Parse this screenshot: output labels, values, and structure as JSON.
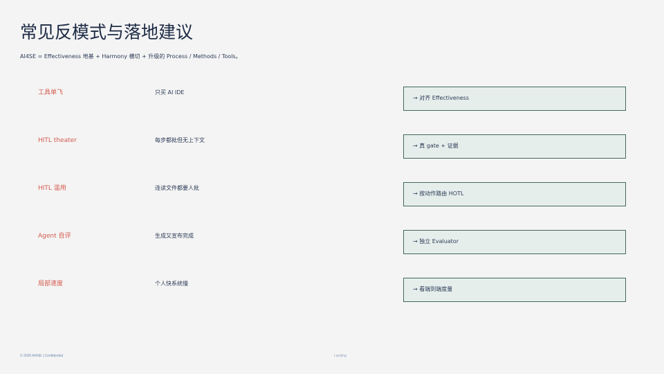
{
  "slide": {
    "title": "常见反模式与落地建议",
    "subtitle": "AI4SE = Effectiveness 地基 + Harmony 横切 + 升级的 Process / Methods / Tools。"
  },
  "rows": [
    {
      "anti_pattern": "工具单飞",
      "symptom": "只买 AI IDE",
      "fix": "→ 对齐 Effectiveness"
    },
    {
      "anti_pattern": "HITL theater",
      "symptom": "每步都批但无上下文",
      "fix": "→ 真 gate + 证据"
    },
    {
      "anti_pattern": "HITL 滥用",
      "symptom": "连读文件都要人批",
      "fix": "→ 按动作路由 HOTL"
    },
    {
      "anti_pattern": "Agent 自评",
      "symptom": "生成又宣布完成",
      "fix": "→ 独立 Evaluator"
    },
    {
      "anti_pattern": "局部速度",
      "symptom": "个人快系统慢",
      "fix": "→ 看端到端度量"
    }
  ],
  "footer": {
    "left": "© 2026  AI4SE  |  Confidential",
    "center": "Landing"
  },
  "colors": {
    "background": "#f4f4f4",
    "title": "#1c2a44",
    "anti_pattern": "#d35a4c",
    "fix_box_fill": "#e6eeec",
    "fix_box_border": "#42685e"
  }
}
